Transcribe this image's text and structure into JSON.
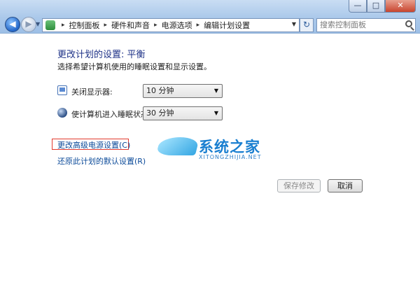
{
  "window": {
    "controls": {
      "minimize": "—",
      "maximize": "□",
      "close": "✕"
    },
    "nav": {
      "back_glyph": "◀",
      "forward_glyph": "▶",
      "dropdown_glyph": "▼",
      "refresh_glyph": "↻"
    },
    "breadcrumb": [
      "控制面板",
      "硬件和声音",
      "电源选项",
      "编辑计划设置"
    ],
    "breadcrumb_sep": "▸",
    "search_placeholder": "搜索控制面板"
  },
  "page": {
    "title": "更改计划的设置: 平衡",
    "subtitle": "选择希望计算机使用的睡眠设置和显示设置。",
    "settings": [
      {
        "label": "关闭显示器:",
        "value": "10 分钟",
        "icon": "display-icon"
      },
      {
        "label": "使计算机进入睡眠状态:",
        "value": "30 分钟",
        "icon": "sleep-icon"
      }
    ],
    "links": {
      "advanced": "更改高级电源设置(C)",
      "restore": "还原此计划的默认设置(R)"
    },
    "buttons": {
      "save": "保存修改",
      "cancel": "取消"
    }
  },
  "watermark": {
    "name": "系统之家",
    "url": "XITONGZHIJIA.NET"
  },
  "colors": {
    "title": "#1e3287",
    "link": "#0b4a99",
    "highlight_box": "#e23a2e"
  }
}
